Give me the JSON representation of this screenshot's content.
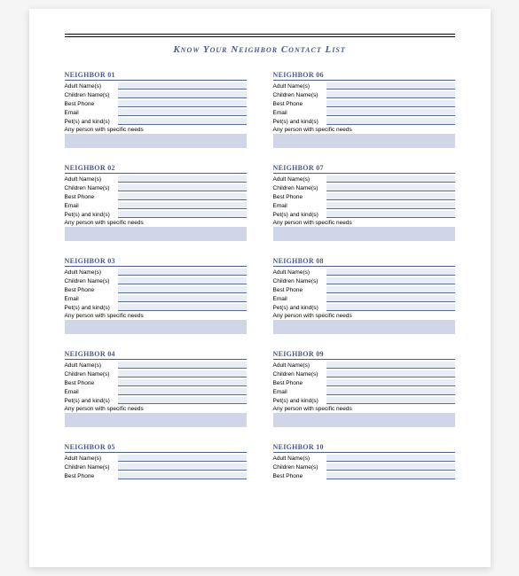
{
  "title": "Know Your Neighbor Contact List",
  "neighbor_label_prefix": "NEIGHBOR",
  "fields": {
    "adult": "Adult Name(s)",
    "children": "Children Name(s)",
    "phone": "Best Phone",
    "email": "Email",
    "pets": "Pet(s) and kind(s)",
    "needs": "Any person with specific needs"
  },
  "left_numbers": [
    "01",
    "02",
    "03",
    "04",
    "05"
  ],
  "right_numbers": [
    "06",
    "07",
    "08",
    "09",
    "10"
  ]
}
